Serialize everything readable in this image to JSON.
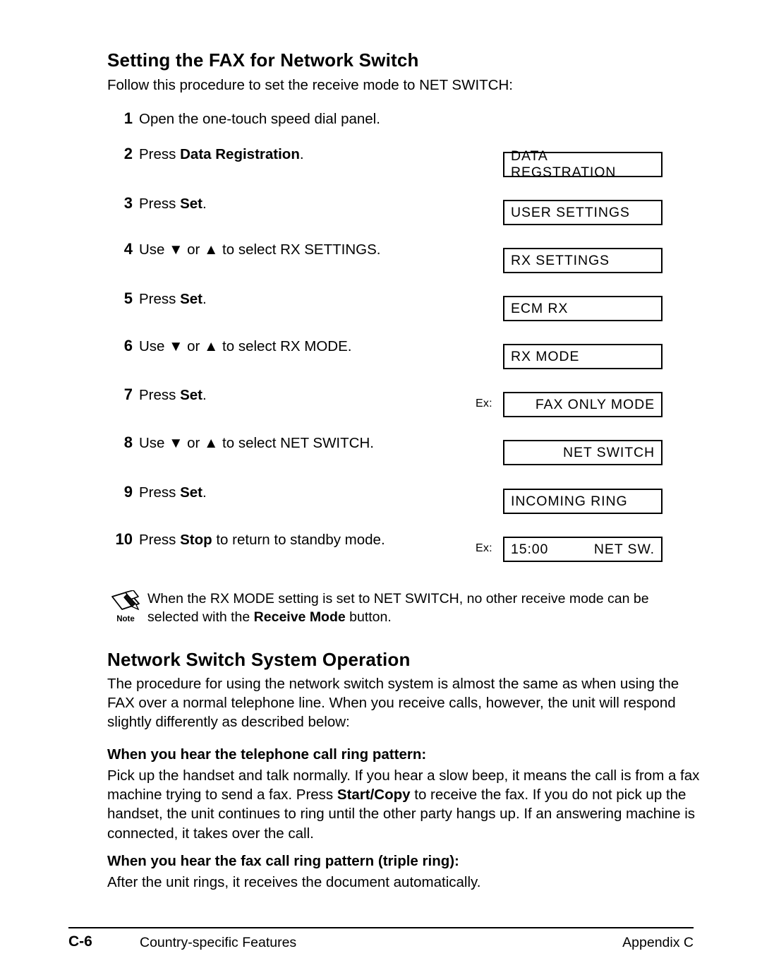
{
  "page": {
    "heading_main": "Setting the FAX for Network Switch",
    "intro": "Follow this procedure to set the receive mode to NET SWITCH:",
    "heading_operation": "Network Switch System Operation"
  },
  "steps": [
    {
      "num": "1",
      "pre": "Open the one-touch speed dial panel.",
      "bold": "",
      "post": ""
    },
    {
      "num": "2",
      "pre": "Press ",
      "bold": "Data Registration",
      "post": "."
    },
    {
      "num": "3",
      "pre": "Press ",
      "bold": "Set",
      "post": "."
    },
    {
      "num": "4",
      "pre": "Use ▼ or ▲ to select RX SETTINGS.",
      "bold": "",
      "post": ""
    },
    {
      "num": "5",
      "pre": "Press ",
      "bold": "Set",
      "post": "."
    },
    {
      "num": "6",
      "pre": "Use ▼ or ▲ to select RX MODE.",
      "bold": "",
      "post": ""
    },
    {
      "num": "7",
      "pre": "Press ",
      "bold": "Set",
      "post": "."
    },
    {
      "num": "8",
      "pre": "Use ▼ or ▲ to select NET SWITCH.",
      "bold": "",
      "post": ""
    },
    {
      "num": "9",
      "pre": "Press ",
      "bold": "Set",
      "post": "."
    },
    {
      "num": "10",
      "pre": "Press ",
      "bold": "Stop",
      "post": " to return to standby mode."
    }
  ],
  "lcd_displays": [
    {
      "text": "DATA REGSTRATION",
      "align": "left",
      "ex": ""
    },
    {
      "text": "USER SETTINGS",
      "align": "left",
      "ex": ""
    },
    {
      "text": "RX SETTINGS",
      "align": "left",
      "ex": ""
    },
    {
      "text": "ECM RX",
      "align": "left",
      "ex": ""
    },
    {
      "text": "RX MODE",
      "align": "left",
      "ex": ""
    },
    {
      "text": "FAX ONLY MODE",
      "align": "right",
      "ex": "Ex:"
    },
    {
      "text": "NET SWITCH",
      "align": "right",
      "ex": ""
    },
    {
      "text": "INCOMING RING",
      "align": "left",
      "ex": ""
    },
    {
      "left": "15:00",
      "right": "NET SW.",
      "align": "split",
      "ex": "Ex:"
    }
  ],
  "note": {
    "icon_label": "Note",
    "text_pre": "When the RX MODE setting is set to NET SWITCH, no other receive mode can be selected with the ",
    "text_bold": "Receive Mode",
    "text_post": " button."
  },
  "content": {
    "intro_paragraph": "The procedure for using the network switch system is almost the same as when using the FAX over a normal telephone line. When you receive calls, however, the unit will respond slightly differently as described below:",
    "subhead_telephone": "When you hear the telephone call ring pattern:",
    "para_telephone_pre": "Pick up the handset and talk normally. If you hear a slow beep, it means the call is from a fax machine trying to send a fax. Press ",
    "para_telephone_bold": "Start/Copy",
    "para_telephone_post": " to receive the fax. If you do not pick up the handset, the unit continues to ring until the other party hangs up. If an answering machine is connected, it takes over the call.",
    "subhead_fax": "When you hear the fax call ring pattern (triple ring):",
    "para_fax": "After the unit rings, it receives the document automatically."
  },
  "footer": {
    "page_number": "C-6",
    "section": "Country-specific Features",
    "appendix": "Appendix C"
  }
}
